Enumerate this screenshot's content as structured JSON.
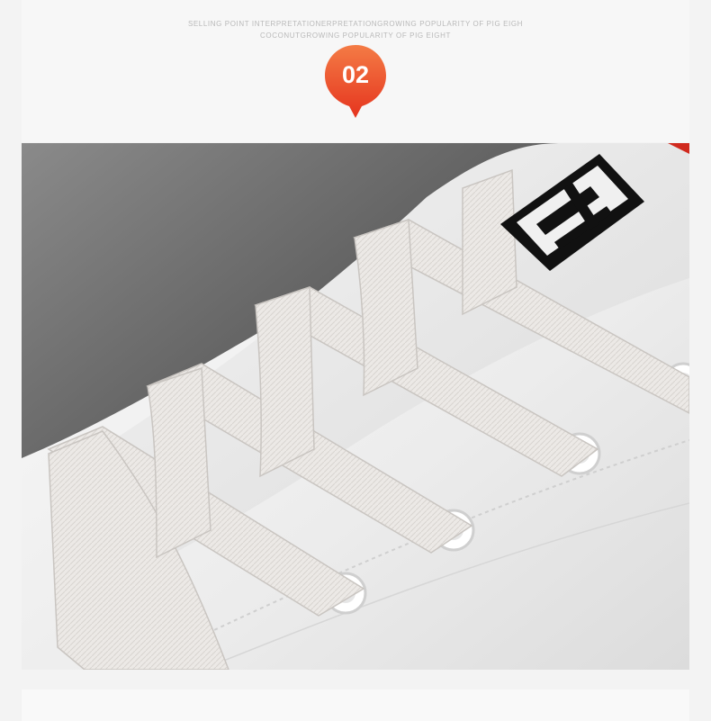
{
  "header": {
    "tagline_line1": "SELLING POINT INTERPRETATIONERPRETATIONGROWING POPULARITY OF PIG EIGH",
    "tagline_line2": "COCONUTGROWING POPULARITY OF PIG EIGHT",
    "badge_number": "02",
    "badge_color_top": "#f47b45",
    "badge_color_bottom": "#e5341e"
  },
  "photo": {
    "subject": "white-sneaker-laces-closeup",
    "background_color": "#5e5e5e",
    "shoe_color": "#f2f2f2",
    "lace_color": "#ebe8e6",
    "logo_color": "#111111",
    "accent_color": "#d02a1e"
  }
}
